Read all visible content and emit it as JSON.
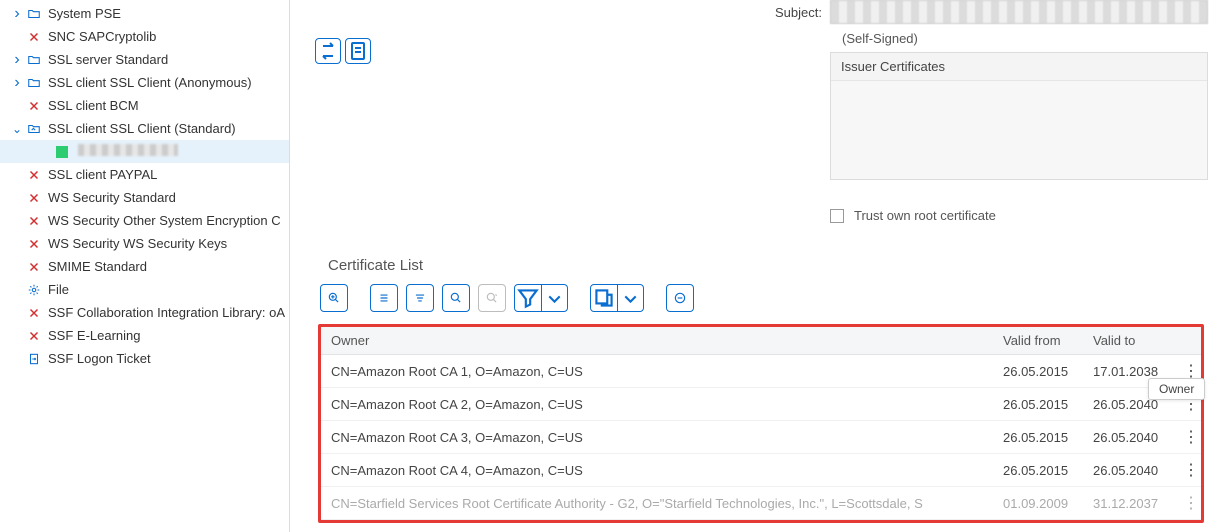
{
  "tree": [
    {
      "twist": ">",
      "icon": "folder",
      "label": "System PSE"
    },
    {
      "twist": "",
      "icon": "x",
      "label": "SNC SAPCryptolib"
    },
    {
      "twist": ">",
      "icon": "folder",
      "label": "SSL server Standard"
    },
    {
      "twist": ">",
      "icon": "folder",
      "label": "SSL client SSL Client (Anonymous)"
    },
    {
      "twist": "",
      "icon": "x",
      "label": "SSL client BCM"
    },
    {
      "twist": "v",
      "icon": "folderlink",
      "label": "SSL client SSL Client (Standard)"
    },
    {
      "twist": "",
      "icon": "green",
      "label": "",
      "child": true,
      "selected": true,
      "blurred": true
    },
    {
      "twist": "",
      "icon": "x",
      "label": "SSL client PAYPAL"
    },
    {
      "twist": "",
      "icon": "x",
      "label": "WS Security Standard"
    },
    {
      "twist": "",
      "icon": "x",
      "label": "WS Security Other System Encryption C"
    },
    {
      "twist": "",
      "icon": "x",
      "label": "WS Security WS Security Keys"
    },
    {
      "twist": "",
      "icon": "x",
      "label": "SMIME Standard"
    },
    {
      "twist": "",
      "icon": "gear",
      "label": "File"
    },
    {
      "twist": "",
      "icon": "x",
      "label": "SSF Collaboration Integration Library: oA"
    },
    {
      "twist": "",
      "icon": "x",
      "label": "SSF E-Learning"
    },
    {
      "twist": "",
      "icon": "docarrow",
      "label": "SSF Logon Ticket"
    }
  ],
  "subject_label": "Subject:",
  "self_signed": "(Self-Signed)",
  "issuer_header": "Issuer Certificates",
  "trust_label": "Trust own root certificate",
  "cert_list_title": "Certificate List",
  "owner_tooltip": "Owner",
  "headers": {
    "owner": "Owner",
    "vf": "Valid from",
    "vt": "Valid to"
  },
  "rows": [
    {
      "owner": "CN=Amazon Root CA 1, O=Amazon, C=US",
      "vf": "26.05.2015",
      "vt": "17.01.2038"
    },
    {
      "owner": "CN=Amazon Root CA 2, O=Amazon, C=US",
      "vf": "26.05.2015",
      "vt": "26.05.2040"
    },
    {
      "owner": "CN=Amazon Root CA 3, O=Amazon, C=US",
      "vf": "26.05.2015",
      "vt": "26.05.2040"
    },
    {
      "owner": "CN=Amazon Root CA 4, O=Amazon, C=US",
      "vf": "26.05.2015",
      "vt": "26.05.2040"
    },
    {
      "owner": "CN=Starfield Services Root Certificate Authority - G2, O=\"Starfield Technologies, Inc.\", L=Scottsdale, S",
      "vf": "01.09.2009",
      "vt": "31.12.2037"
    }
  ]
}
